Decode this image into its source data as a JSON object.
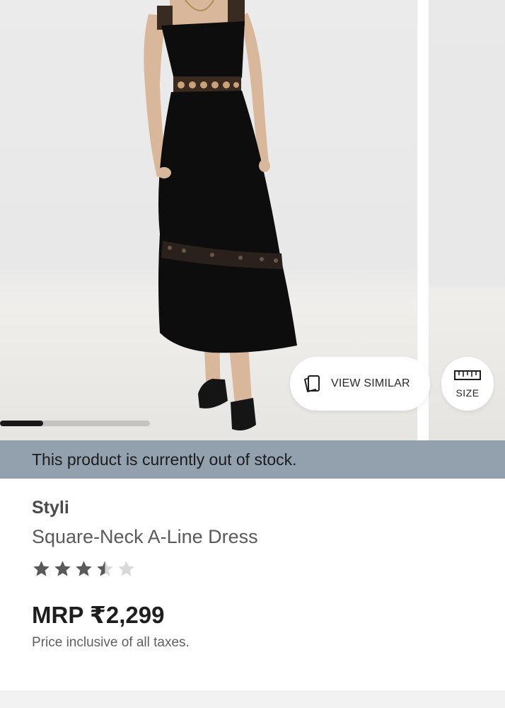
{
  "gallery": {
    "image_alt": "Model wearing black square-neck A-line dress with crochet trim",
    "progress_fraction": 0.29,
    "view_similar_label": "VIEW SIMILAR",
    "size_label": "SIZE"
  },
  "banner": {
    "text": "This product is currently out of stock."
  },
  "product": {
    "brand": "Styli",
    "name": "Square-Neck A-Line Dress",
    "rating": 3.5,
    "rating_max": 5,
    "price": "MRP ₹2,299",
    "tax_note": "Price inclusive of all taxes."
  },
  "icons": {
    "view_similar": "cards-icon",
    "size": "ruler-icon",
    "star": "star-icon"
  },
  "colors": {
    "banner_bg": "#93a1ae",
    "star_filled": "#595959",
    "star_empty": "#d9d9d9"
  }
}
